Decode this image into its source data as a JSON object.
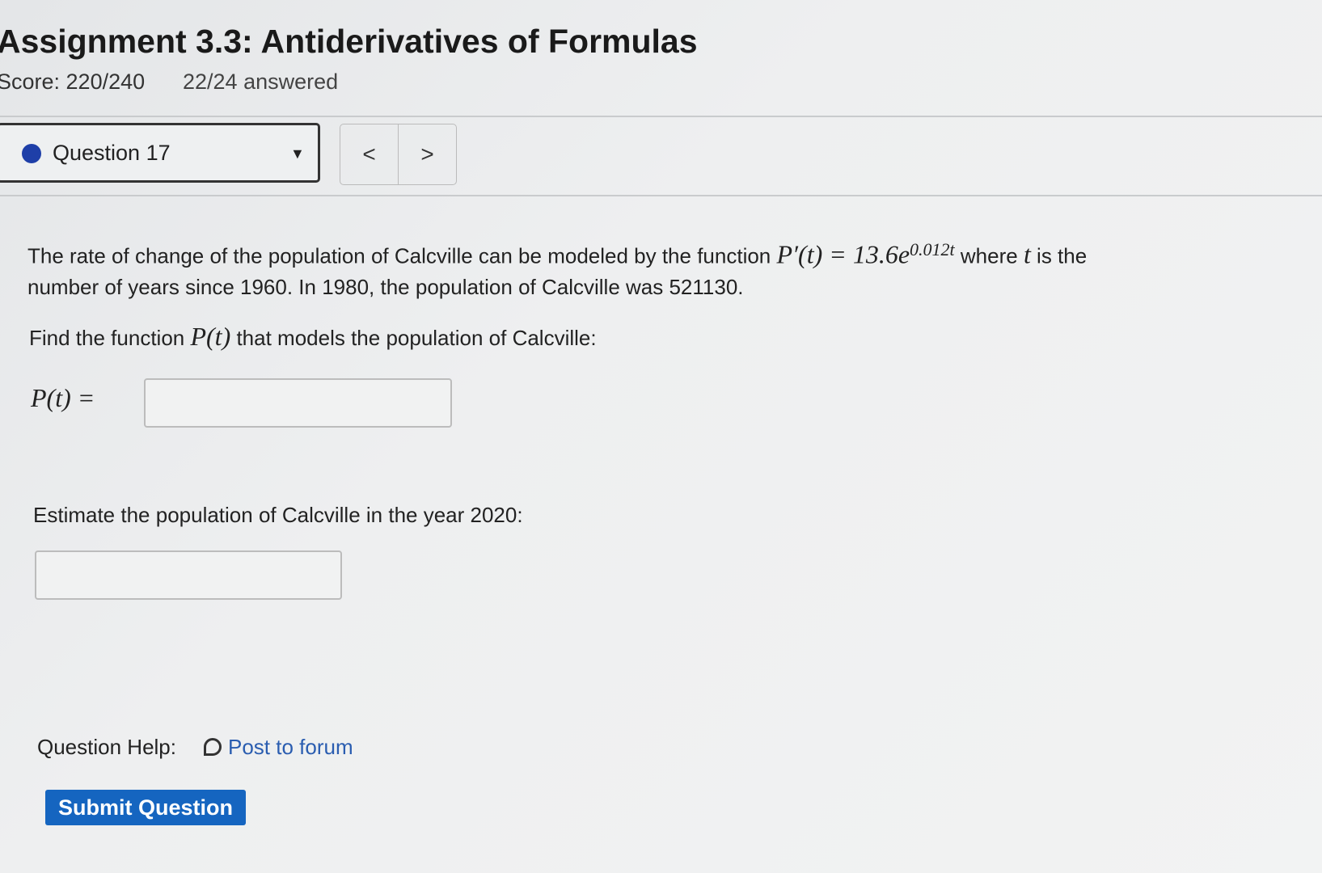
{
  "header": {
    "title": "Assignment 3.3: Antiderivatives of Formulas",
    "score": "Score: 220/240",
    "answered": "22/24 answered"
  },
  "nav": {
    "question_label": "Question 17",
    "prev": "<",
    "next": ">"
  },
  "question": {
    "p1a": "The rate of change of the population of Calcville can be modeled by the function ",
    "formula": "P′(t) = 13.6e",
    "exponent": "0.012t",
    "p1b": " where ",
    "t": "t",
    "p1c": " is the",
    "p2": "number of years since 1960.  In 1980, the population of Calcville was 521130.",
    "find_a": "Find the function ",
    "find_fn": "P(t)",
    "find_b": " that models the population of Calcville:",
    "pt_label": "P(t) =",
    "pt_value": "",
    "estimate": "Estimate the population of Calcville in the year 2020:",
    "estimate_value": ""
  },
  "help": {
    "label": "Question Help:",
    "forum": "Post to forum"
  },
  "submit": "Submit Question",
  "colors": {
    "accent": "#1565c0",
    "dot": "#1e3fa8",
    "link": "#2a5db0"
  }
}
